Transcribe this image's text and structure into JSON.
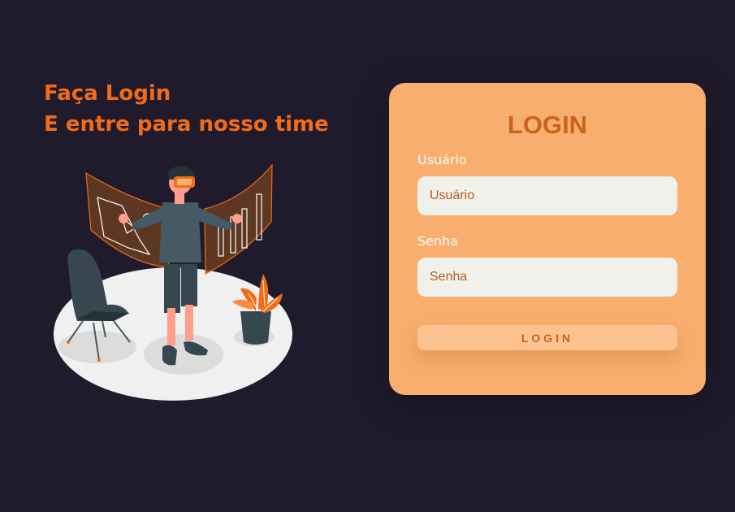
{
  "hero": {
    "line1": "Faça Login",
    "line2": "E entre para nosso time"
  },
  "login_card": {
    "title": "LOGIN",
    "username_label": "Usuário",
    "username_placeholder": "Usuário",
    "password_label": "Senha",
    "password_placeholder": "Senha",
    "button_label": "LOGIN"
  },
  "colors": {
    "background": "#201b2c",
    "accent": "#f26c18",
    "card": "#f8ae6e",
    "input": "#f0f1eb",
    "button": "#fcc28f",
    "card_text": "#c8651b"
  },
  "illustration": {
    "icon": "vr-person-illustration"
  }
}
